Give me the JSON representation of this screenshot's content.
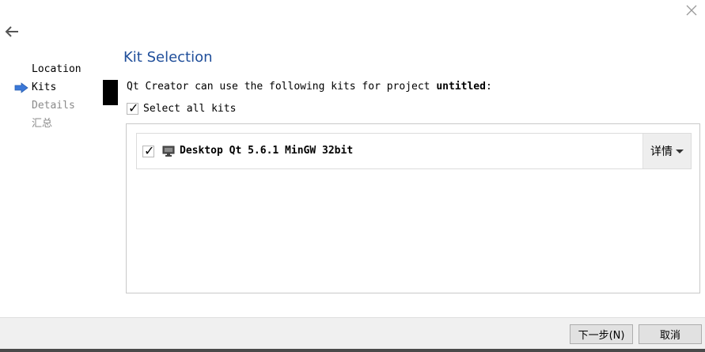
{
  "wizard": {
    "steps": [
      {
        "label": "Location",
        "state": "done"
      },
      {
        "label": "Kits",
        "state": "current"
      },
      {
        "label": "Details",
        "state": "pending"
      },
      {
        "label": "汇总",
        "state": "pending"
      }
    ]
  },
  "page": {
    "title": "Kit Selection",
    "description_prefix": "Qt Creator can use the following kits for project ",
    "project_name": "untitled",
    "description_suffix": ":",
    "select_all_label": "Select all kits",
    "select_all_checked": true
  },
  "kits": [
    {
      "name": "Desktop Qt 5.6.1 MinGW 32bit",
      "checked": true,
      "icon": "monitor-icon",
      "details_label": "详情"
    }
  ],
  "footer": {
    "next_label": "下一步(N)",
    "cancel_label": "取消"
  },
  "colors": {
    "title": "#1f4e9a",
    "current_step_arrow": "#3b78d8"
  }
}
